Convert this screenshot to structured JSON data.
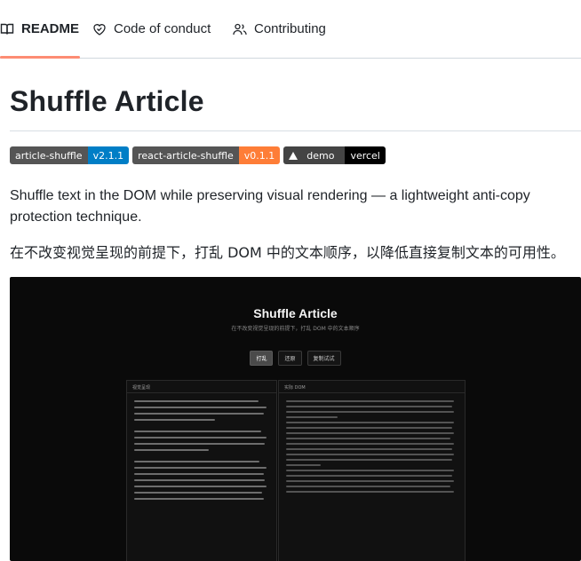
{
  "tabs": [
    {
      "label": "README",
      "icon": "book-icon",
      "active": true
    },
    {
      "label": "Code of conduct",
      "icon": "heart-icon",
      "active": false
    },
    {
      "label": "Contributing",
      "icon": "people-icon",
      "active": false
    }
  ],
  "title": "Shuffle Article",
  "badges": [
    {
      "label": "article-shuffle",
      "value": "v2.1.1",
      "color": "#007ec6"
    },
    {
      "label": "react-article-shuffle",
      "value": "v0.1.1",
      "color": "#fe7d37"
    },
    {
      "label": "demo",
      "value": "vercel",
      "color": "#000000",
      "icon": "triangle-icon"
    }
  ],
  "description_en": "Shuffle text in the DOM while preserving visual rendering — a lightweight anti-copy protection technique.",
  "description_zh": "在不改变视觉呈现的前提下，打乱 DOM 中的文本顺序，以降低直接复制文本的可用性。",
  "screenshot": {
    "title": "Shuffle Article",
    "subtitle": "在不改变视觉呈现的前提下，打乱 DOM 中的文本顺序",
    "buttons": [
      "打乱",
      "还原",
      "复制试试"
    ],
    "left_panel_label": "视觉呈现",
    "right_panel_label": "实际 DOM"
  }
}
